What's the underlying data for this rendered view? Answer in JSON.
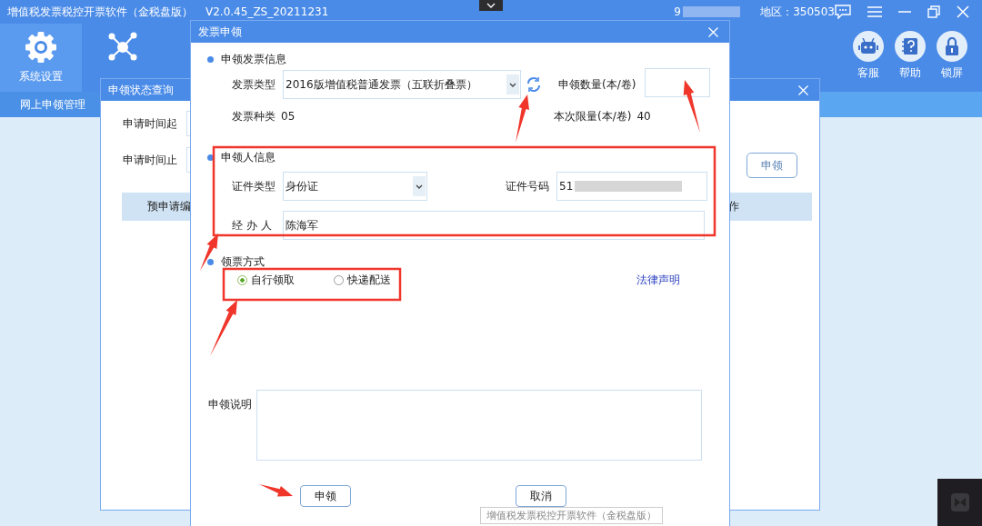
{
  "app": {
    "title": "增值税发票税控开票软件（金税盘版）",
    "version": "V2.0.45_ZS_20211231",
    "taxpayer_id": "9",
    "region": "地区：350503"
  },
  "toolbar_left": [
    {
      "label": "系统设置"
    }
  ],
  "toolbar_right": [
    {
      "label": "客服"
    },
    {
      "label": "帮助"
    },
    {
      "label": "锁屏"
    }
  ],
  "nav_tab": "网上申领管理",
  "status_dialog": {
    "title": "申领状态查询",
    "fields": [
      "申请时间起",
      "申请时间止"
    ],
    "apply_button": "申领",
    "table_columns": [
      "预申请编",
      "作"
    ]
  },
  "apply_dialog": {
    "title": "发票申领",
    "invoice_section": {
      "heading": "申领发票信息",
      "type_label": "发票类型",
      "type_value": "2016版增值税普通发票（五联折叠票）",
      "quantity_label": "申领数量(本/卷)",
      "kind_label": "发票种类",
      "kind_value": "05",
      "limit_label": "本次限量(本/卷)",
      "limit_value": "40"
    },
    "applicant_section": {
      "heading": "申领人信息",
      "id_type_label": "证件类型",
      "id_type_value": "身份证",
      "id_number_label": "证件号码",
      "id_number_value": "51",
      "handler_label": "经 办 人",
      "handler_value": "陈海军"
    },
    "pickup_section": {
      "heading": "领票方式",
      "options": [
        {
          "label": "自行领取",
          "selected": true
        },
        {
          "label": "快递配送",
          "selected": false
        }
      ],
      "legal_link": "法律声明"
    },
    "note_label": "申领说明",
    "buttons": [
      "申领",
      "取消"
    ]
  },
  "tooltip": "增值税发票税控开票软件（金税盘版）"
}
